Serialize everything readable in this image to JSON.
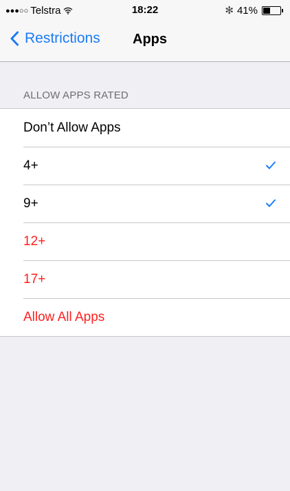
{
  "status": {
    "signal_dots": "●●●○○",
    "carrier": "Telstra",
    "time": "18:22",
    "bluetooth": "✻",
    "battery_percent": "41%",
    "battery_level": 0.41
  },
  "nav": {
    "back_label": "Restrictions",
    "title": "Apps",
    "accent_color": "#1a7cf5"
  },
  "section": {
    "header": "ALLOW APPS RATED"
  },
  "rows": [
    {
      "label": "Don’t Allow Apps",
      "checked": false,
      "red": false
    },
    {
      "label": "4+",
      "checked": true,
      "red": false
    },
    {
      "label": "9+",
      "checked": true,
      "red": false
    },
    {
      "label": "12+",
      "checked": false,
      "red": true
    },
    {
      "label": "17+",
      "checked": false,
      "red": true
    },
    {
      "label": "Allow All Apps",
      "checked": false,
      "red": true
    }
  ],
  "colors": {
    "red": "#fe1f1f",
    "check": "#1a7cf5"
  }
}
